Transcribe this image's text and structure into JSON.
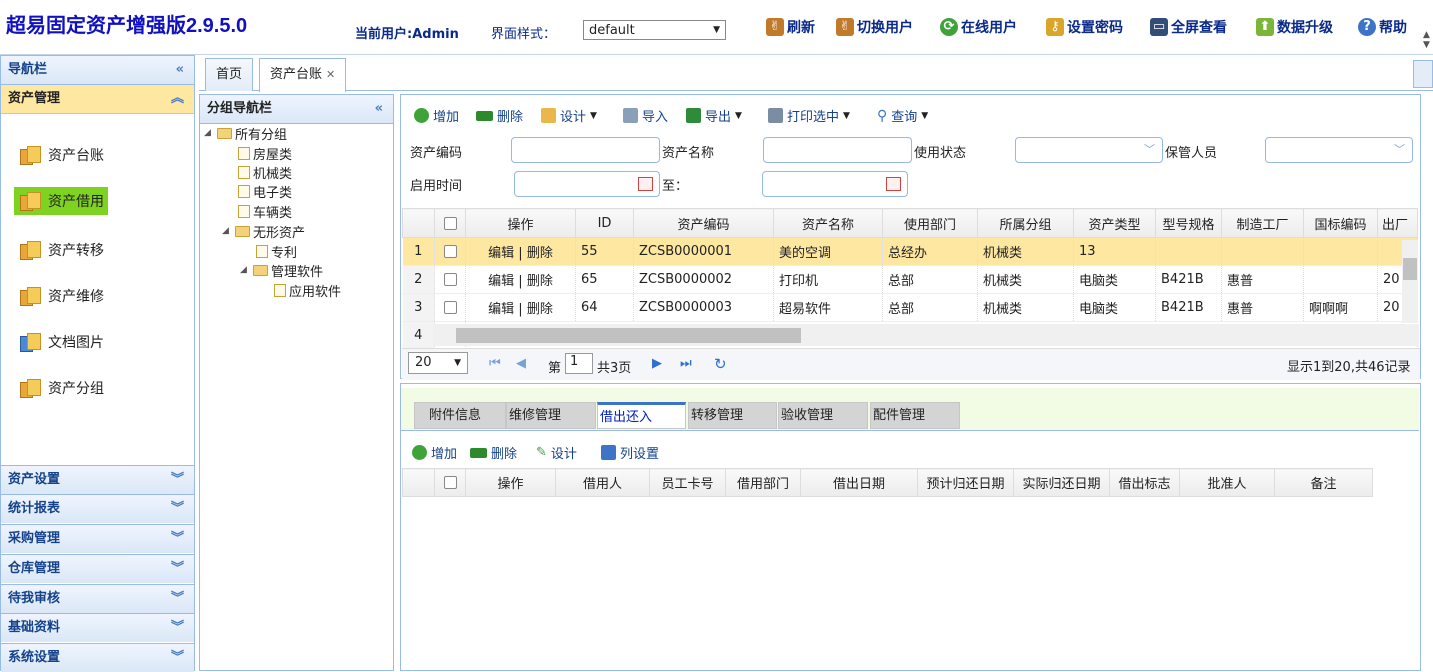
{
  "header": {
    "app_title": "超易固定资产增强版2.9.5.0",
    "current_user": "当前用户:Admin",
    "style_label": "界面样式：",
    "style_value": "default",
    "buttons": [
      {
        "label": "刷新",
        "icon": "tool-icon",
        "color": "#c07a2a"
      },
      {
        "label": "切换用户",
        "icon": "tool-icon",
        "color": "#c07a2a"
      },
      {
        "label": "在线用户",
        "icon": "refresh-green-icon",
        "color": "#3fa33a"
      },
      {
        "label": "设置密码",
        "icon": "key-icon",
        "color": "#d9a52b"
      },
      {
        "label": "全屏查看",
        "icon": "monitor-icon",
        "color": "#334d77"
      },
      {
        "label": "数据升级",
        "icon": "upgrade-icon",
        "color": "#7bb53a"
      },
      {
        "label": "帮助",
        "icon": "help-icon",
        "color": "#3d74c7"
      }
    ]
  },
  "nav": {
    "title": "导航栏",
    "active_group": "资产管理",
    "items": [
      "资产台账",
      "资产借用",
      "资产转移",
      "资产维修",
      "文档图片",
      "资产分组"
    ],
    "selected_item": "资产借用",
    "footer_groups": [
      "资产设置",
      "统计报表",
      "采购管理",
      "仓库管理",
      "待我审核",
      "基础资料",
      "系统设置"
    ]
  },
  "tabs": [
    {
      "label": "首页"
    },
    {
      "label": "资产台账"
    }
  ],
  "group_nav": {
    "title": "分组导航栏",
    "tree": [
      {
        "label": "所有分组",
        "type": "folder"
      },
      {
        "label": "房屋类",
        "type": "file"
      },
      {
        "label": "机械类",
        "type": "file"
      },
      {
        "label": "电子类",
        "type": "file"
      },
      {
        "label": "车辆类",
        "type": "file"
      },
      {
        "label": "无形资产",
        "type": "folder"
      },
      {
        "label": "专利",
        "type": "file"
      },
      {
        "label": "管理软件",
        "type": "folder"
      },
      {
        "label": "应用软件",
        "type": "file"
      }
    ]
  },
  "toolbar": {
    "add": "增加",
    "delete": "删除",
    "design": "设计",
    "import": "导入",
    "export": "导出",
    "print": "打印选中",
    "query": "查询"
  },
  "filters": {
    "code_label": "资产编码",
    "name_label": "资产名称",
    "status_label": "使用状态",
    "keeper_label": "保管人员",
    "start_label": "启用时间",
    "to_label": "至："
  },
  "grid": {
    "columns": [
      "操作",
      "ID",
      "资产编码",
      "资产名称",
      "使用部门",
      "所属分组",
      "资产类型",
      "型号规格",
      "制造工厂",
      "国标编码",
      "出厂"
    ],
    "rows": [
      {
        "rn": "1",
        "op": "编辑 | 删除",
        "id": "55",
        "code": "ZCSB0000001",
        "name": "美的空调",
        "dept": "总经办",
        "group": "机械类",
        "type": "13",
        "model": "",
        "factory": "",
        "gb": "",
        "out": ""
      },
      {
        "rn": "2",
        "op": "编辑 | 删除",
        "id": "65",
        "code": "ZCSB0000002",
        "name": "打印机",
        "dept": "总部",
        "group": "机械类",
        "type": "电脑类",
        "model": "B421B",
        "factory": "惠普",
        "gb": "",
        "out": "20"
      },
      {
        "rn": "3",
        "op": "编辑 | 删除",
        "id": "64",
        "code": "ZCSB0000003",
        "name": "超易软件",
        "dept": "总部",
        "group": "机械类",
        "type": "电脑类",
        "model": "B421B",
        "factory": "惠普",
        "gb": "啊啊啊",
        "out": "20"
      },
      {
        "rn": "4",
        "op": "",
        "id": "",
        "code": "",
        "name": "",
        "dept": "",
        "group": "",
        "type": "",
        "model": "",
        "factory": "",
        "gb": "",
        "out": ""
      }
    ]
  },
  "pager": {
    "page_size": "20",
    "page_prefix": "第",
    "page_value": "1",
    "page_total": "共3页",
    "summary": "显示1到20,共46记录"
  },
  "detail": {
    "tabs": [
      "附件信息",
      "维修管理",
      "借出还入",
      "转移管理",
      "验收管理",
      "配件管理"
    ],
    "active_tab": "借出还入",
    "toolbar": {
      "add": "增加",
      "delete": "删除",
      "design": "设计",
      "columns": "列设置"
    },
    "columns": [
      "操作",
      "借用人",
      "员工卡号",
      "借用部门",
      "借出日期",
      "预计归还日期",
      "实际归还日期",
      "借出标志",
      "批准人",
      "备注"
    ]
  }
}
